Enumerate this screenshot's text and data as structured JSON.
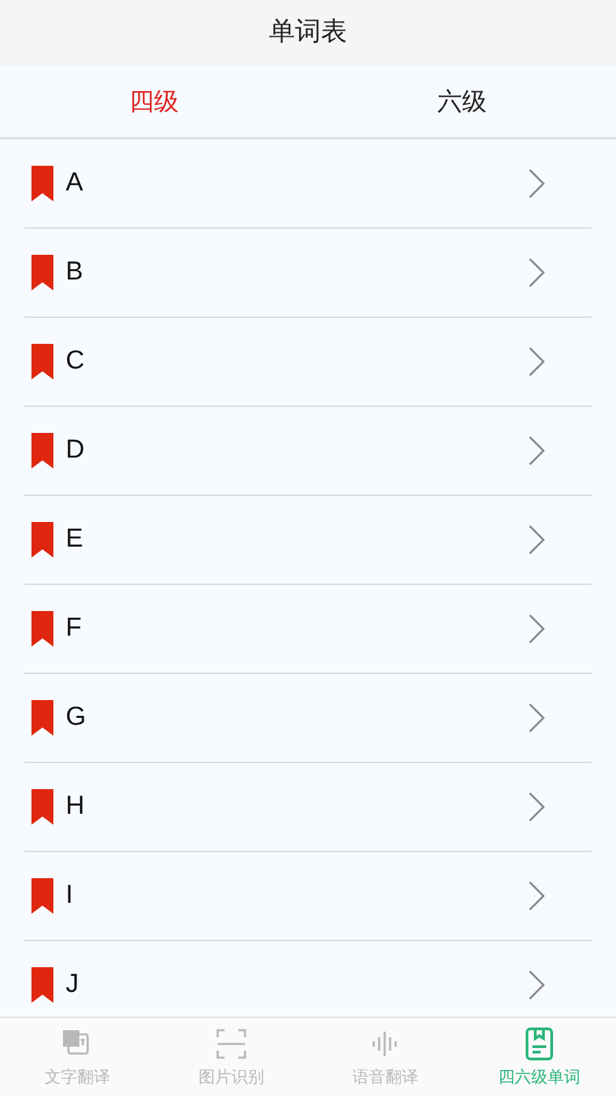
{
  "header": {
    "title": "单词表"
  },
  "tabs": [
    {
      "label": "四级",
      "selected": true
    },
    {
      "label": "六级",
      "selected": false
    }
  ],
  "letters": [
    "A",
    "B",
    "C",
    "D",
    "E",
    "F",
    "G",
    "H",
    "I",
    "J"
  ],
  "nav": [
    {
      "kind": "translate",
      "label": "文字翻译",
      "selected": false
    },
    {
      "kind": "scan",
      "label": "图片识别",
      "selected": false
    },
    {
      "kind": "voice",
      "label": "语音翻译",
      "selected": false
    },
    {
      "kind": "book",
      "label": "四六级单词",
      "selected": true
    }
  ]
}
